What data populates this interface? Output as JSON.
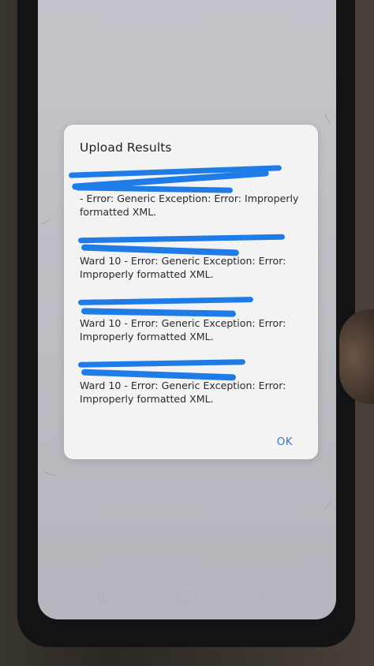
{
  "dialog": {
    "title": "Upload Results",
    "entries": [
      {
        "visible_text": "- Error: Generic Exception: Error: Improperly formatted XML."
      },
      {
        "visible_text": "Ward 10 - Error: Generic Exception: Error: Improperly formatted XML."
      },
      {
        "visible_text": "Ward 10 - Error: Generic Exception: Error: Improperly formatted XML."
      },
      {
        "visible_text": "Ward 10 - Error: Generic Exception: Error: Improperly formatted XML."
      }
    ],
    "ok_label": "OK"
  },
  "navbar": {
    "recent_glyph": "|||",
    "home_glyph": "◯",
    "back_glyph": "‹"
  },
  "colors": {
    "accent": "#3178d4",
    "redaction": "#1f7ce6"
  }
}
